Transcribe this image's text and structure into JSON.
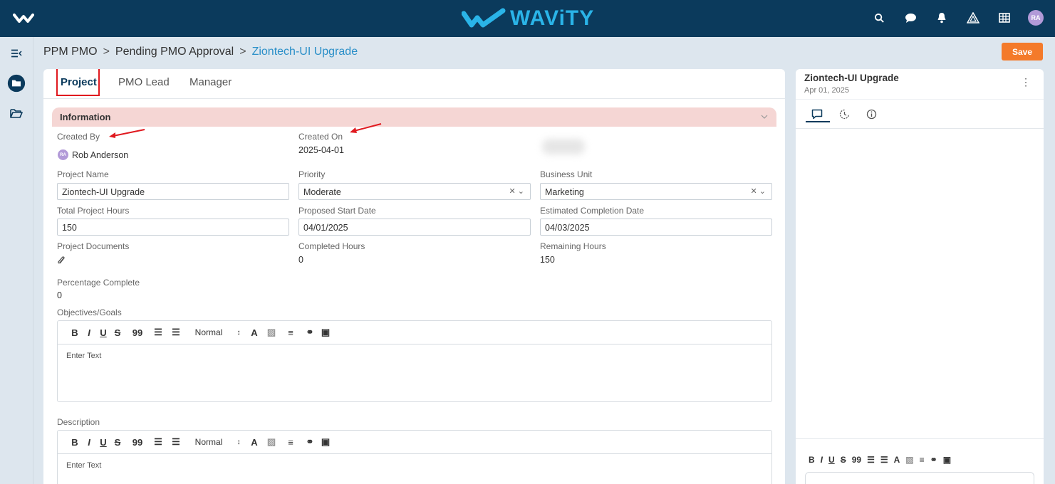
{
  "topbar": {
    "brand": "WAViTY",
    "avatar": "RA",
    "icons": [
      "search-icon",
      "chat-icon",
      "bell-icon",
      "delta-icon",
      "grid-icon"
    ]
  },
  "breadcrumb": {
    "items": [
      "PPM PMO",
      "Pending PMO Approval"
    ],
    "separator": ">",
    "current": "Ziontech-UI Upgrade"
  },
  "save_label": "Save",
  "tabs": [
    "Project",
    "PMO Lead",
    "Manager"
  ],
  "section": {
    "title": "Information"
  },
  "fields": {
    "created_by": {
      "label": "Created By",
      "value": "Rob Anderson",
      "avatar": "RA"
    },
    "created_on": {
      "label": "Created On",
      "value": "2025-04-01"
    },
    "project_name": {
      "label": "Project Name",
      "value": "Ziontech-UI Upgrade"
    },
    "priority": {
      "label": "Priority",
      "value": "Moderate"
    },
    "business_unit": {
      "label": "Business Unit",
      "value": "Marketing"
    },
    "total_hours": {
      "label": "Total Project Hours",
      "value": "150"
    },
    "start_date": {
      "label": "Proposed Start Date",
      "value": "04/01/2025"
    },
    "completion_date": {
      "label": "Estimated Completion Date",
      "value": "04/03/2025"
    },
    "documents": {
      "label": "Project Documents"
    },
    "completed_hours": {
      "label": "Completed Hours",
      "value": "0"
    },
    "remaining_hours": {
      "label": "Remaining Hours",
      "value": "150"
    },
    "percentage": {
      "label": "Percentage Complete",
      "value": "0"
    }
  },
  "editors": {
    "objectives": {
      "label": "Objectives/Goals",
      "placeholder": "Enter Text",
      "format": "Normal"
    },
    "description": {
      "label": "Description",
      "placeholder": "Enter Text",
      "format": "Normal"
    }
  },
  "toolbar": {
    "bold": "B",
    "italic": "I",
    "underline": "U",
    "strike": "S",
    "quote": "99",
    "select_arrow": "↕"
  },
  "right_panel": {
    "title": "Ziontech-UI Upgrade",
    "date": "Apr 01, 2025"
  },
  "colors": {
    "topbar": "#0b3a5c",
    "brand": "#2ab4e8",
    "save": "#f47a2a",
    "section_header": "#f5d6d4",
    "link": "#2a8fc8",
    "annotation": "#e0191f"
  }
}
